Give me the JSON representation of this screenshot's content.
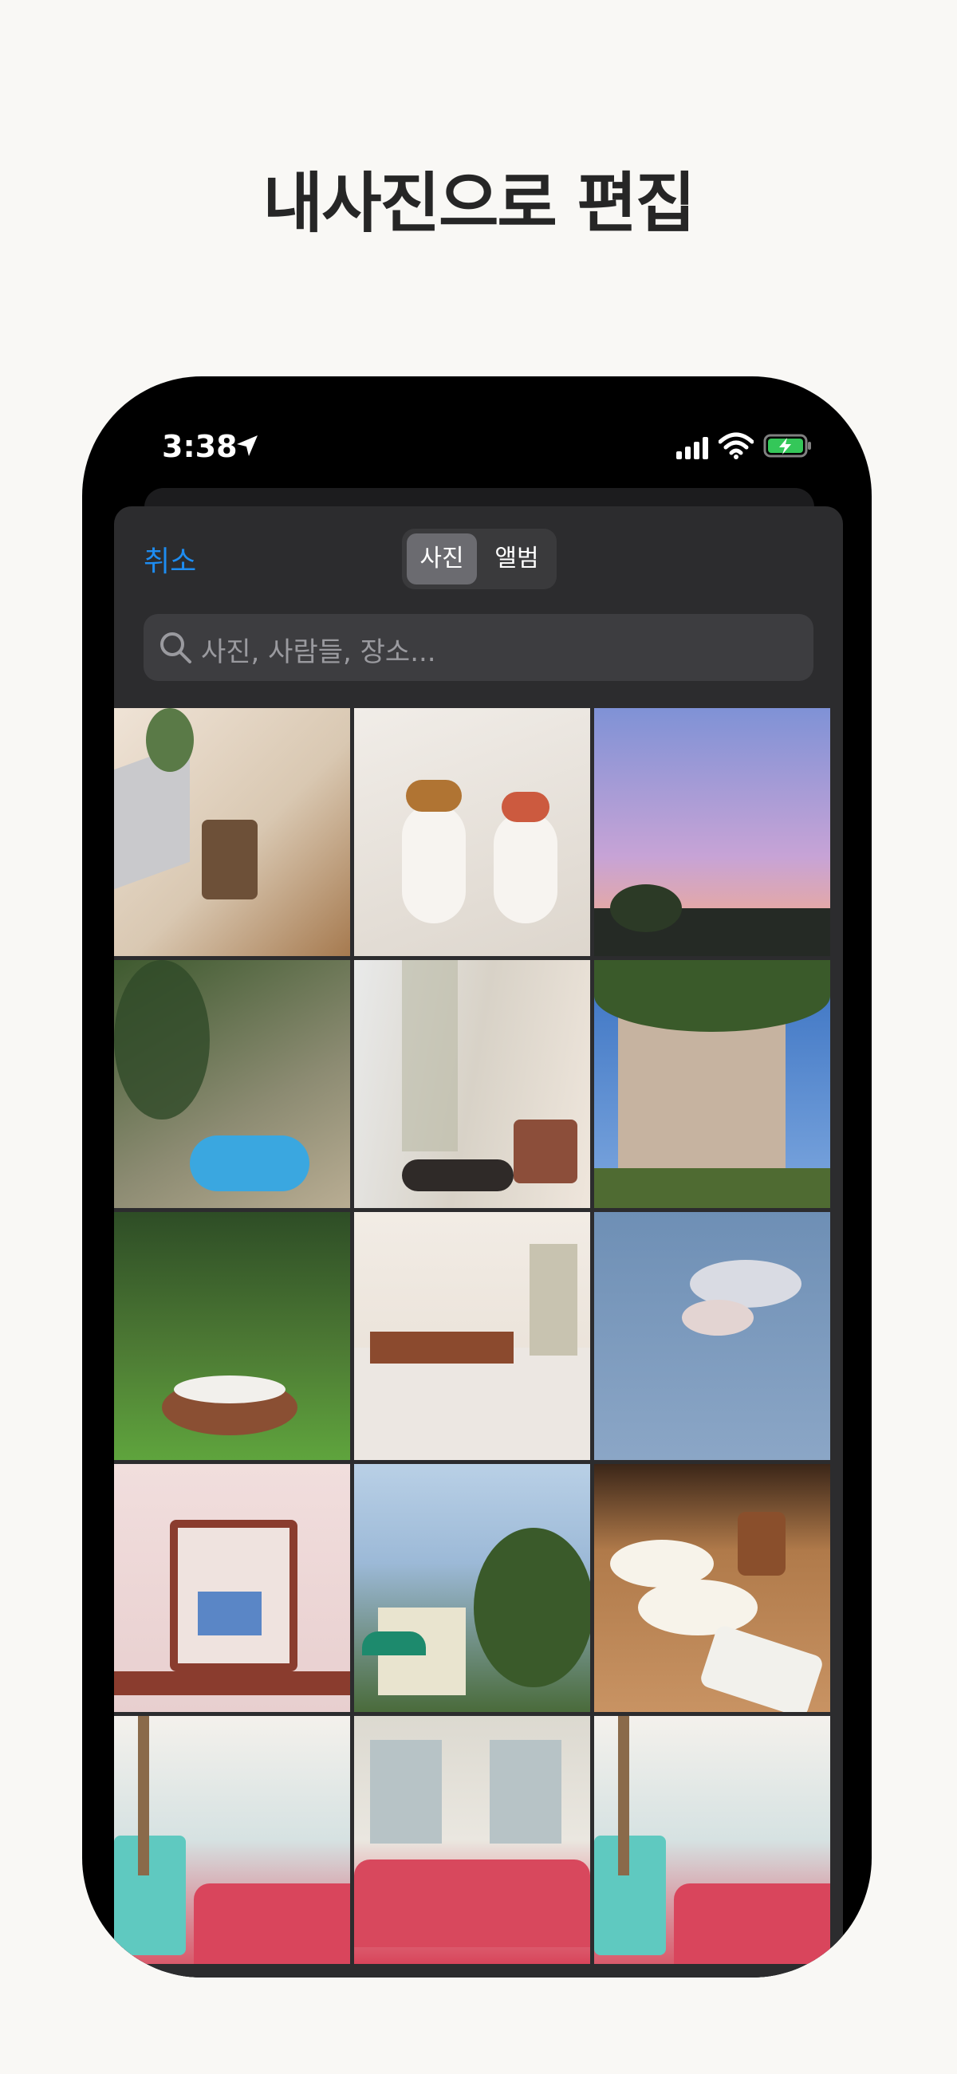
{
  "headline": "내사진으로 편집",
  "status_bar": {
    "time": "3:38"
  },
  "picker": {
    "cancel_label": "취소",
    "segments": [
      "사진",
      "앨범"
    ],
    "search_placeholder": "사진, 사람들, 장소..."
  },
  "colors": {
    "accent": "#1e8cf0",
    "battery": "#34c759"
  },
  "icons": [
    "location-arrow-icon",
    "cellular-signal-icon",
    "wifi-icon",
    "battery-charging-icon",
    "search-icon"
  ]
}
